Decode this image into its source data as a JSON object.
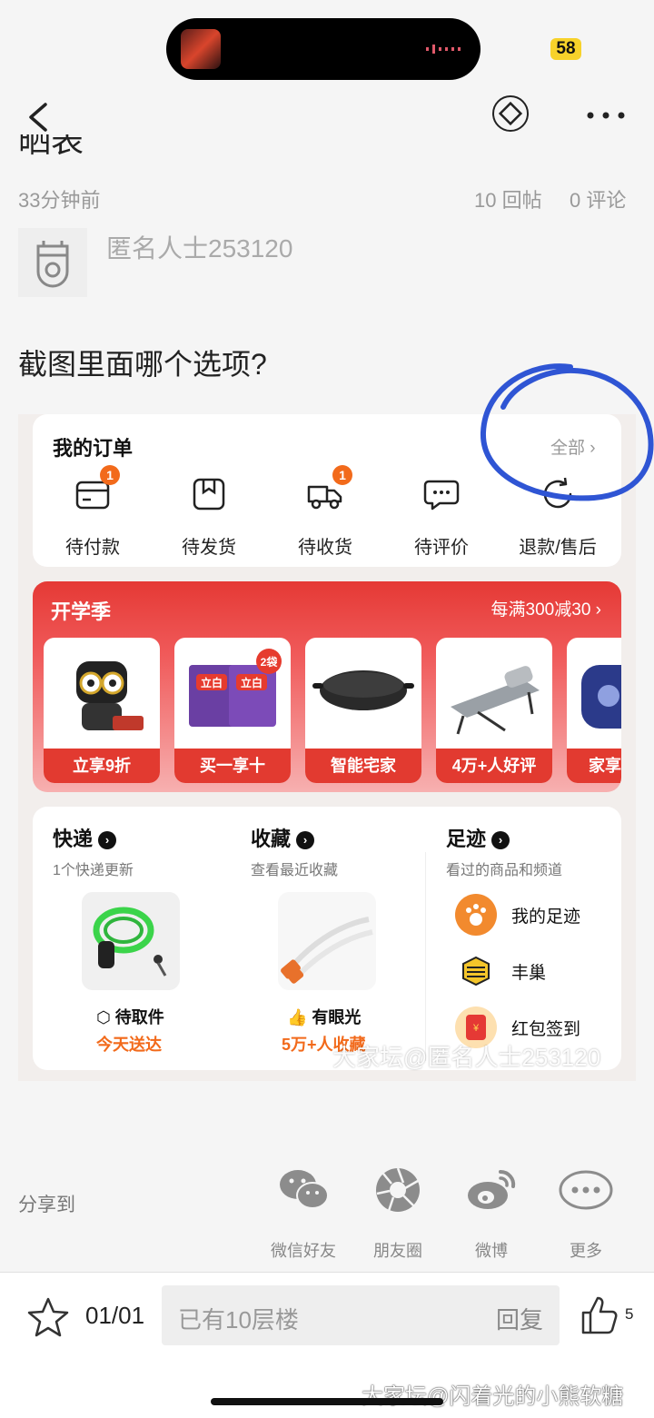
{
  "status_bar": {
    "battery": "58"
  },
  "post": {
    "title_partial": "晒表",
    "time": "33分钟前",
    "replies": "10 回帖",
    "comments": "0 评论",
    "author": "匿名人士253120",
    "question": "截图里面哪个选项?"
  },
  "screenshot": {
    "orders": {
      "title": "我的订单",
      "all_link": "全部 ›",
      "items": [
        {
          "label": "待付款",
          "badge": "1"
        },
        {
          "label": "待发货",
          "badge": ""
        },
        {
          "label": "待收货",
          "badge": "1"
        },
        {
          "label": "待评价",
          "badge": ""
        },
        {
          "label": "退款/售后",
          "badge": ""
        }
      ]
    },
    "promo": {
      "title": "开学季",
      "link": "每满300减30 ›",
      "products": [
        {
          "tag": "立享9折"
        },
        {
          "tag": "买一享十",
          "pic_text": "立白",
          "pic_badge": "2袋"
        },
        {
          "tag": "智能宅家"
        },
        {
          "tag": "4万+人好评"
        },
        {
          "tag": "家享"
        }
      ]
    },
    "express": {
      "title": "快递",
      "sub": "1个快递更新",
      "line": "待取件",
      "note": "今天送达"
    },
    "favorites": {
      "title": "收藏",
      "sub": "查看最近收藏",
      "line": "有眼光",
      "note": "5万+人收藏"
    },
    "footprints": {
      "title": "足迹",
      "sub": "看过的商品和频道",
      "items": [
        "我的足迹",
        "丰巢",
        "红包签到"
      ]
    },
    "watermark": "大家坛@匿名人士253120",
    "annotation_color": "#2f55d4"
  },
  "share": {
    "label": "分享到",
    "items": [
      "微信好友",
      "朋友圈",
      "微博",
      "更多"
    ]
  },
  "bottom": {
    "pager": "01/01",
    "reply_placeholder": "已有10层楼",
    "reply_button": "回复",
    "likes": "5",
    "watermark": "大家坛@闪着光的小熊软糖"
  },
  "colors": {
    "accent_orange": "#f26a1b",
    "promo_red": "#e53935"
  }
}
